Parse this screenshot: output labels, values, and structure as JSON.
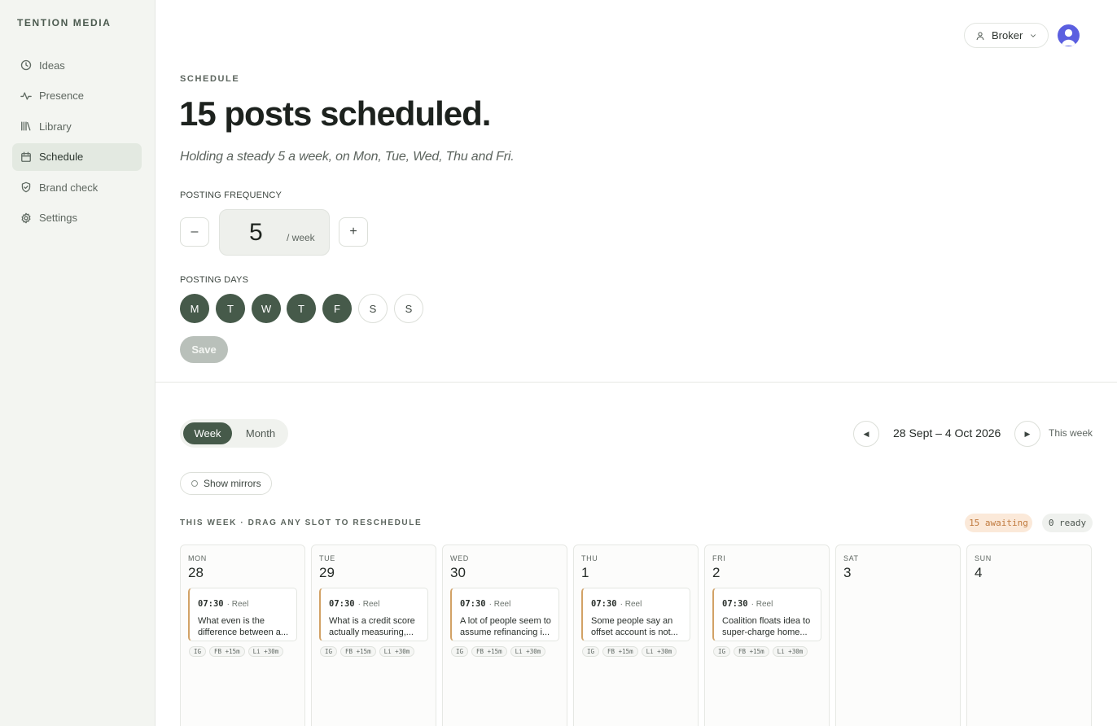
{
  "app": {
    "brand": "TENTION MEDIA"
  },
  "sidebar": {
    "items": [
      {
        "label": "Ideas",
        "icon": "clock-icon"
      },
      {
        "label": "Presence",
        "icon": "activity-icon"
      },
      {
        "label": "Library",
        "icon": "library-icon"
      },
      {
        "label": "Schedule",
        "icon": "calendar-icon",
        "active": true
      },
      {
        "label": "Brand check",
        "icon": "shield-check-icon"
      },
      {
        "label": "Settings",
        "icon": "gear-icon"
      }
    ]
  },
  "topbar": {
    "role_label": "Broker"
  },
  "header": {
    "eyebrow": "SCHEDULE",
    "title": "15 posts scheduled.",
    "subtitle": "Holding a steady 5 a week, on Mon, Tue, Wed, Thu and Fri."
  },
  "frequency": {
    "label": "POSTING FREQUENCY",
    "decrement": "–",
    "value": "5",
    "unit": "/ week",
    "increment": "+"
  },
  "posting_days": {
    "label": "POSTING DAYS",
    "days": [
      {
        "letter": "M",
        "selected": true
      },
      {
        "letter": "T",
        "selected": true
      },
      {
        "letter": "W",
        "selected": true
      },
      {
        "letter": "T",
        "selected": true
      },
      {
        "letter": "F",
        "selected": true
      },
      {
        "letter": "S",
        "selected": false
      },
      {
        "letter": "S",
        "selected": false
      }
    ]
  },
  "save_label": "Save",
  "calendar": {
    "view_week": "Week",
    "view_month": "Month",
    "prev_glyph": "◀",
    "next_glyph": "▶",
    "range": "28 Sept – 4 Oct 2026",
    "this_week": "This week",
    "show_mirrors": "Show mirrors",
    "week_caption": "THIS WEEK · DRAG ANY SLOT TO RESCHEDULE",
    "awaiting": "15 awaiting",
    "ready": "0 ready",
    "days": [
      {
        "dow": "MON",
        "num": "28",
        "post": {
          "time": "07:30",
          "type": "· Reel",
          "text": "What even is the difference between a...",
          "tags": [
            "IG",
            "FB +15m",
            "Li +30m"
          ]
        }
      },
      {
        "dow": "TUE",
        "num": "29",
        "post": {
          "time": "07:30",
          "type": "· Reel",
          "text": "What is a credit score actually measuring,...",
          "tags": [
            "IG",
            "FB +15m",
            "Li +30m"
          ]
        }
      },
      {
        "dow": "WED",
        "num": "30",
        "post": {
          "time": "07:30",
          "type": "· Reel",
          "text": "A lot of people seem to assume refinancing i...",
          "tags": [
            "IG",
            "FB +15m",
            "Li +30m"
          ]
        }
      },
      {
        "dow": "THU",
        "num": "1",
        "post": {
          "time": "07:30",
          "type": "· Reel",
          "text": "Some people say an offset account is not...",
          "tags": [
            "IG",
            "FB +15m",
            "Li +30m"
          ]
        }
      },
      {
        "dow": "FRI",
        "num": "2",
        "post": {
          "time": "07:30",
          "type": "· Reel",
          "text": "Coalition floats idea to super-charge home...",
          "tags": [
            "IG",
            "FB +15m",
            "Li +30m"
          ]
        }
      },
      {
        "dow": "SAT",
        "num": "3"
      },
      {
        "dow": "SUN",
        "num": "4"
      }
    ]
  },
  "colors": {
    "accent": "#465a4a",
    "sidebar_bg": "#f3f5f1",
    "awaiting_bg": "#fbe9d9",
    "awaiting_text": "#c07a3e",
    "avatar": "#5b5fe0",
    "card_stripe": "#d2a266"
  }
}
